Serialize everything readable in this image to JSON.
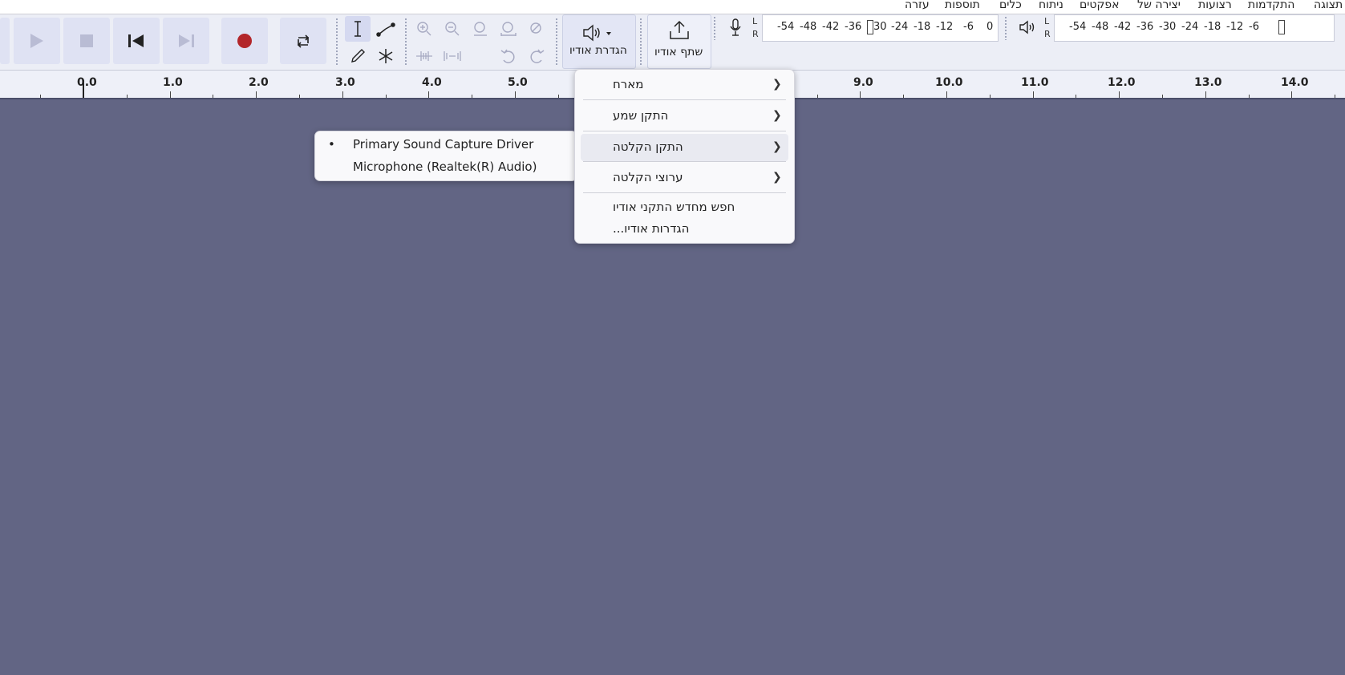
{
  "menubar": {
    "items": [
      "תצוגה",
      "התקדמות",
      "רצועות",
      "יצירה של",
      "אפקטים",
      "ניתוח",
      "כלים",
      "תוספות",
      "עזרה"
    ]
  },
  "toolbar": {
    "transport": [
      "play-button",
      "stop-button",
      "skip-start-button",
      "skip-end-button",
      "record-button",
      "loop-button"
    ],
    "audio_setup_label": "הגדרת אודיו",
    "share_audio_label": "שתף אודיו",
    "record_meter": {
      "lr": [
        "L",
        "R"
      ],
      "ticks": [
        "-54",
        "-48",
        "-42",
        "-36",
        "30",
        "-24",
        "-18",
        "-12",
        "-6",
        "0"
      ]
    },
    "play_meter": {
      "lr": [
        "L",
        "R"
      ],
      "ticks": [
        "-54",
        "-48",
        "-42",
        "-36",
        "-30",
        "-24",
        "-18",
        "-12",
        "-6"
      ]
    }
  },
  "ruler": {
    "labels": [
      "0.0",
      "1.0",
      "2.0",
      "3.0",
      "4.0",
      "5.0",
      "9.0",
      "10.0",
      "11.0",
      "12.0",
      "13.0",
      "14.0"
    ]
  },
  "audio_setup_menu": {
    "items": [
      {
        "label": "מארח",
        "has_submenu": true
      },
      {
        "label": "התקן שמע",
        "has_submenu": true
      },
      {
        "label": "התקן הקלטה",
        "has_submenu": true,
        "highlighted": true
      },
      {
        "label": "ערוצי הקלטה",
        "has_submenu": true
      },
      {
        "label": "חפש מחדש התקני אודיו",
        "has_submenu": false
      },
      {
        "label": "הגדרות אודיו...",
        "has_submenu": false
      }
    ]
  },
  "recording_device_submenu": {
    "items": [
      {
        "label": "Primary Sound Capture Driver",
        "selected": true
      },
      {
        "label": "Microphone (Realtek(R) Audio)",
        "selected": false
      }
    ],
    "bullet": "•"
  },
  "colors": {
    "track_area": "#626584",
    "record_red": "#b3262a"
  }
}
